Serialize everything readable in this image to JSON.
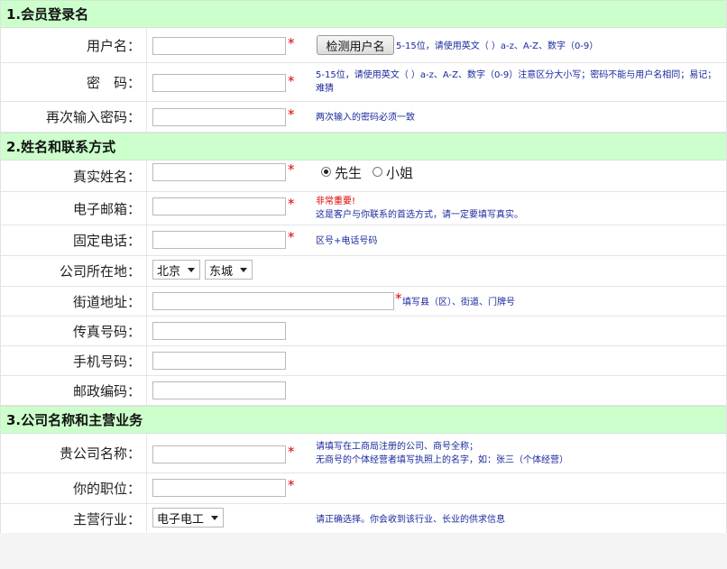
{
  "sections": {
    "s1": "1.会员登录名",
    "s2": "2.姓名和联系方式",
    "s3": "3.公司名称和主营业务"
  },
  "labels": {
    "username": "用户名：",
    "password": "密　码：",
    "confirm": "再次输入密码：",
    "realname": "真实姓名：",
    "email": "电子邮箱：",
    "phone": "固定电话：",
    "location": "公司所在地：",
    "street": "街道地址：",
    "fax": "传真号码：",
    "mobile": "手机号码：",
    "postcode": "邮政编码：",
    "company": "贵公司名称：",
    "position": "你的职位：",
    "industry": "主营行业："
  },
  "required_mark": "*",
  "buttons": {
    "check_username": "检测用户名"
  },
  "hints": {
    "username": "5-15位，请使用英文（ ）a-z、A-Z、数字（0-9）",
    "password_1": "5-15位，请使用英文（ ）a-z、A-Z、数字（0-9）注意区分大小写；密码不能与用户名相同；易记；",
    "password_2": "难猜",
    "confirm": "两次输入的密码必须一致",
    "email_warn": "非常重要!",
    "email": "这是客户与你联系的首选方式，请一定要填写真实。",
    "phone": "区号+电话号码",
    "street": "填写县（区）、街道、门牌号",
    "company_1": "请填写在工商局注册的公司、商号全称；",
    "company_2": "无商号的个体经营者填写执照上的名字，如：张三（个体经营）",
    "industry": "请正确选择。你会收到该行业、长业的供求信息"
  },
  "gender": {
    "male": "先生",
    "female": "小姐",
    "selected": "male"
  },
  "selects": {
    "province": "北京",
    "district": "东城",
    "industry": "电子电工"
  },
  "colors": {
    "section_bg": "#ccffcc",
    "required": "#e00000",
    "hint": "#1a2a9c"
  }
}
